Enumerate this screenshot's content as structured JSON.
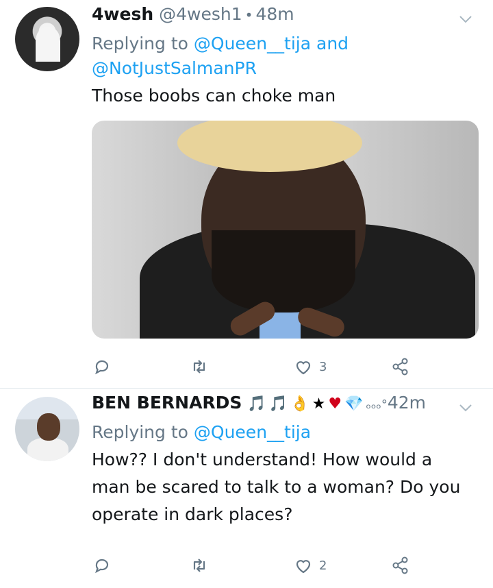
{
  "tweets": [
    {
      "display_name": "4wesh",
      "handle": "@4wesh1",
      "time": "48m",
      "replying_prefix": "Replying to",
      "replying_mention1": "@Queen__tija",
      "replying_and": "and",
      "replying_mention2": "@NotJustSalmanPR",
      "text": "Those boobs can choke man",
      "actions": {
        "reply_count": "",
        "retweet_count": "",
        "like_count": "3"
      }
    },
    {
      "display_name": "BEN BERNARDS",
      "name_emojis": [
        "🎵",
        "🎵",
        "👌",
        "★",
        "♥",
        "💎",
        "ₒₒₒ°"
      ],
      "time": "42m",
      "replying_prefix": "Replying to",
      "replying_mention1": "@Queen__tija",
      "text": "How?? I don't understand! How would a man be scared to talk to a woman? Do you operate in dark places?",
      "actions": {
        "reply_count": "",
        "retweet_count": "",
        "like_count": "2"
      }
    }
  ],
  "colors": {
    "text": "#14171a",
    "secondary": "#657786",
    "link": "#1da1f2",
    "divider": "#e1e8ed"
  },
  "icons": [
    "reply-icon",
    "retweet-icon",
    "like-icon",
    "share-icon",
    "chevron-down-icon"
  ]
}
